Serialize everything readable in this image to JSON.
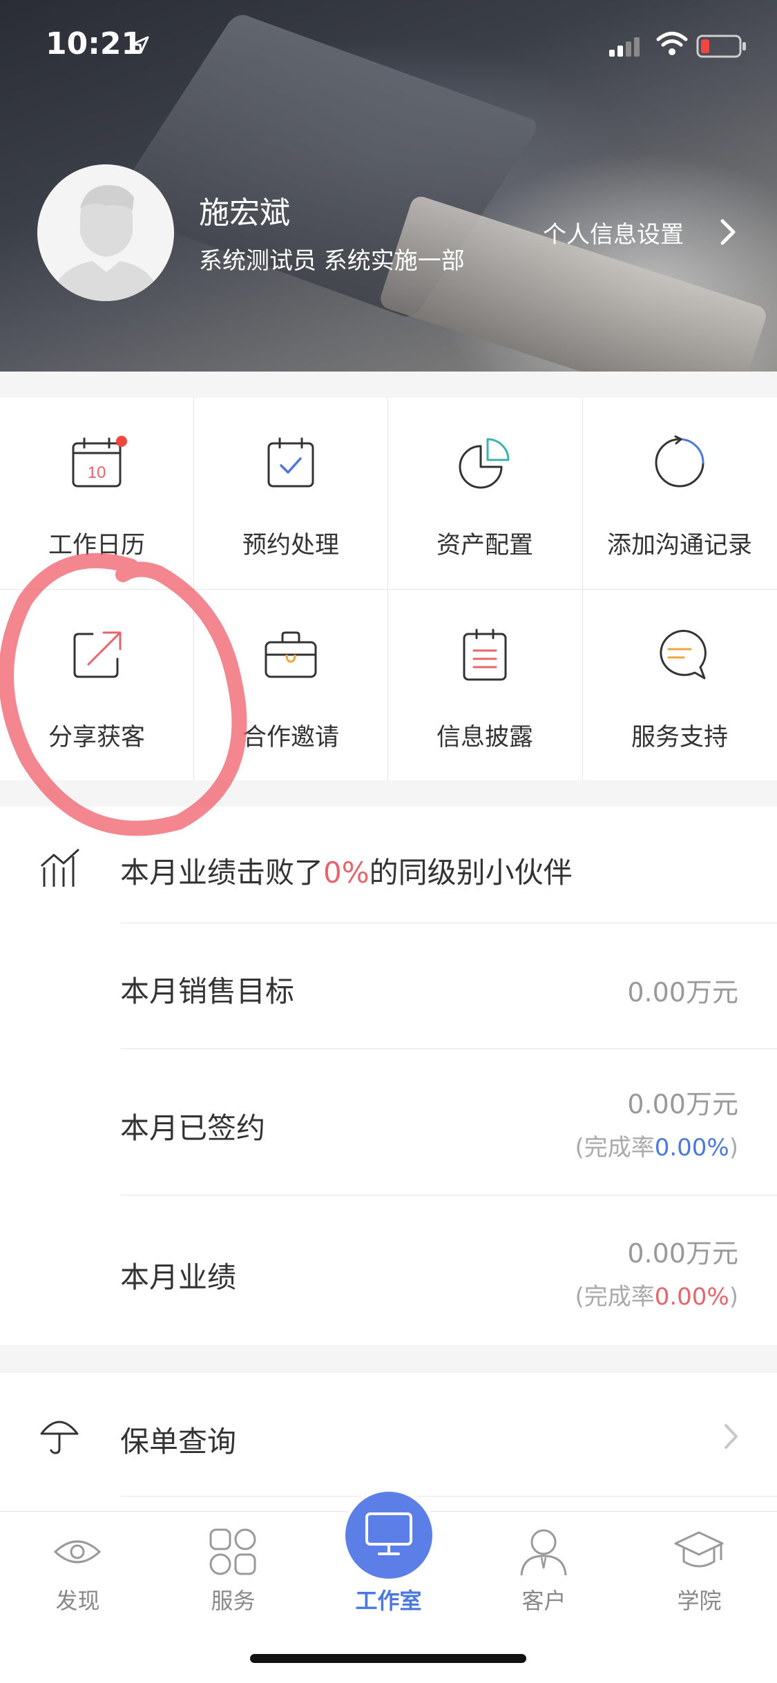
{
  "status_bar": {
    "time": "10:21"
  },
  "profile": {
    "name": "施宏斌",
    "role": "系统测试员 系统实施一部",
    "settings_label": "个人信息设置"
  },
  "grid": {
    "items": [
      {
        "label": "工作日历",
        "icon": "calendar-icon",
        "badge_text": "10"
      },
      {
        "label": "预约处理",
        "icon": "calendar-check-icon"
      },
      {
        "label": "资产配置",
        "icon": "pie-chart-icon"
      },
      {
        "label": "添加沟通记录",
        "icon": "refresh-circle-icon"
      },
      {
        "label": "分享获客",
        "icon": "share-icon"
      },
      {
        "label": "合作邀请",
        "icon": "briefcase-icon"
      },
      {
        "label": "信息披露",
        "icon": "clipboard-icon"
      },
      {
        "label": "服务支持",
        "icon": "chat-bubble-icon"
      }
    ]
  },
  "performance": {
    "headline_prefix": "本月业绩击败了",
    "headline_percent": "0%",
    "headline_suffix": "的同级别小伙伴",
    "rows": [
      {
        "label": "本月销售目标",
        "value": "0.00万元"
      },
      {
        "label": "本月已签约",
        "value": "0.00万元",
        "rate_prefix": "(完成率",
        "rate": "0.00%",
        "rate_suffix": ")",
        "rate_color": "#4a78e0"
      },
      {
        "label": "本月业绩",
        "value": "0.00万元",
        "rate_prefix": "(完成率",
        "rate": "0.00%",
        "rate_suffix": ")",
        "rate_color": "#e8636a"
      }
    ]
  },
  "policy": {
    "label": "保单查询"
  },
  "tabbar": {
    "tabs": [
      {
        "label": "发现",
        "icon": "eye-icon"
      },
      {
        "label": "服务",
        "icon": "grid-icon"
      },
      {
        "label": "工作室",
        "icon": "monitor-icon",
        "active": true
      },
      {
        "label": "客户",
        "icon": "person-icon"
      },
      {
        "label": "学院",
        "icon": "graduation-cap-icon"
      }
    ]
  },
  "colors": {
    "accent": "#5b7fe6",
    "highlight_red": "#e8636a",
    "active_tab": "#4a78e0"
  }
}
